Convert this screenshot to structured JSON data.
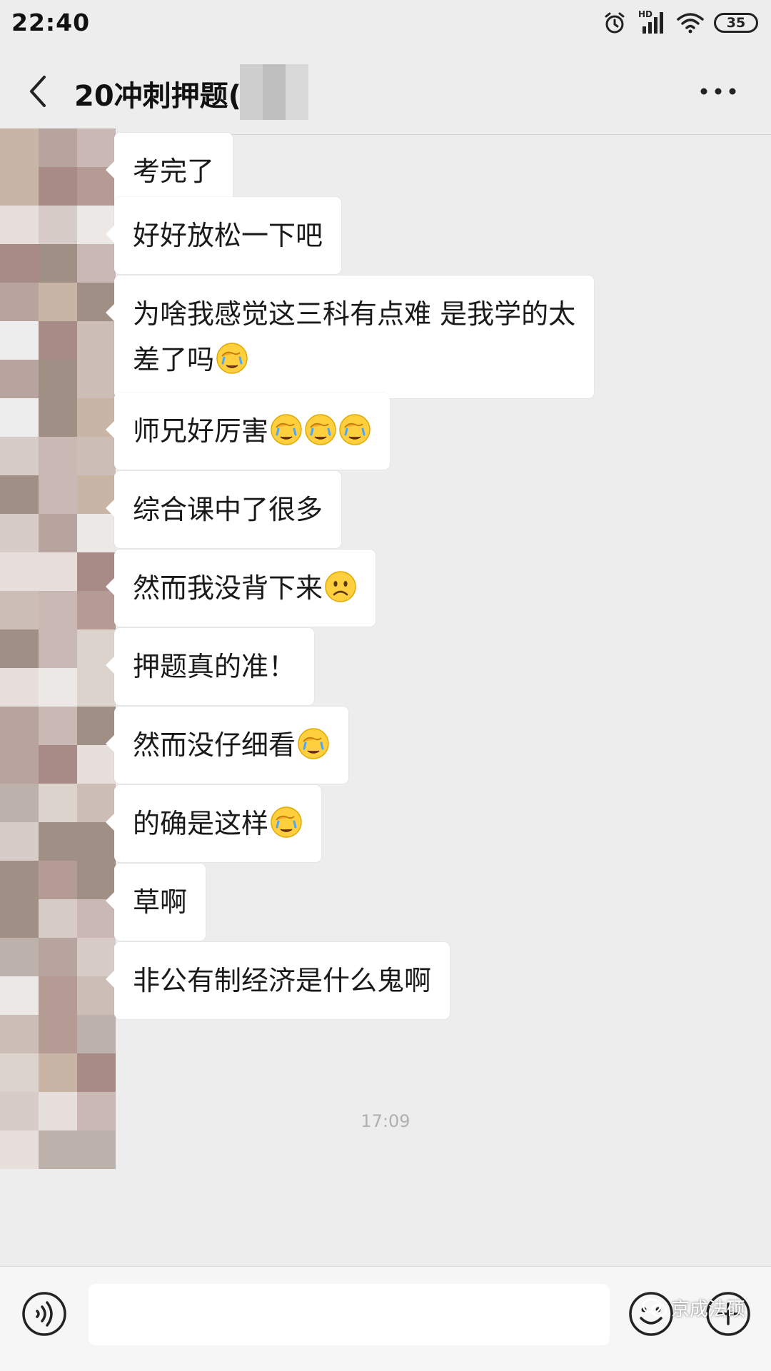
{
  "status_bar": {
    "time": "22:40",
    "battery": "35",
    "network_label": "HD"
  },
  "header": {
    "title": "20冲刺押题(",
    "back_icon": "chevron-left-icon",
    "more_icon": "more-dots-icon"
  },
  "messages": [
    {
      "text": "考完了",
      "emoji_count": 0
    },
    {
      "text": "好好放松一下吧",
      "emoji_count": 0
    },
    {
      "text": "为啥我感觉这三科有点难 是我学的太\n差了吗",
      "emoji": "facepalm-cry-emoji",
      "emoji_count": 1
    },
    {
      "text": "师兄好厉害",
      "emoji": "facepalm-cry-emoji",
      "emoji_count": 3
    },
    {
      "text": "综合课中了很多",
      "emoji_count": 0
    },
    {
      "text": "然而我没背下来",
      "emoji": "sad-face-emoji",
      "emoji_count": 1
    },
    {
      "text": "押题真的准！",
      "emoji_count": 0
    },
    {
      "text": "然而没仔细看",
      "emoji": "facepalm-cry-emoji",
      "emoji_count": 1
    },
    {
      "text": "的确是这样",
      "emoji": "facepalm-cry-emoji",
      "emoji_count": 1
    },
    {
      "text": "草啊",
      "emoji_count": 0
    },
    {
      "text": "非公有制经济是什么鬼啊",
      "emoji_count": 0
    }
  ],
  "timestamp": "17:09",
  "input_bar": {
    "placeholder": "",
    "voice_icon": "voice-icon",
    "emoji_icon": "emoji-face-icon",
    "plus_icon": "plus-circle-icon"
  },
  "watermark": {
    "text": "京成法硕",
    "icon": "wechat-logo-icon"
  },
  "colors": {
    "background": "#ededed",
    "bubble": "#ffffff",
    "input_bar": "#f6f6f6"
  }
}
